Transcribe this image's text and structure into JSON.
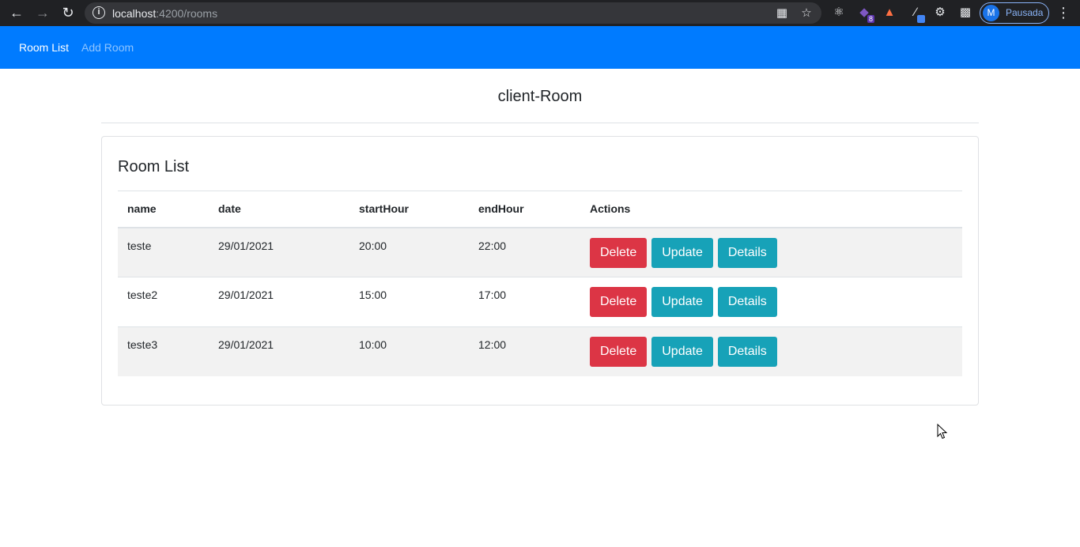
{
  "browser": {
    "url_host": "localhost",
    "url_rest": ":4200/rooms",
    "profile_initial": "M",
    "profile_label": "Pausada",
    "extension_badge": "8"
  },
  "navbar": {
    "links": [
      "Room List",
      "Add Room"
    ]
  },
  "page": {
    "title": "client-Room",
    "card_title": "Room List"
  },
  "table": {
    "headers": [
      "name",
      "date",
      "startHour",
      "endHour",
      "Actions"
    ],
    "rows": [
      {
        "name": "teste",
        "date": "29/01/2021",
        "startHour": "20:00",
        "endHour": "22:00"
      },
      {
        "name": "teste2",
        "date": "29/01/2021",
        "startHour": "15:00",
        "endHour": "17:00"
      },
      {
        "name": "teste3",
        "date": "29/01/2021",
        "startHour": "10:00",
        "endHour": "12:00"
      }
    ],
    "actions": {
      "delete": "Delete",
      "update": "Update",
      "details": "Details"
    }
  },
  "colors": {
    "navbar": "#007bff",
    "danger": "#dc3545",
    "info": "#17a2b8"
  }
}
